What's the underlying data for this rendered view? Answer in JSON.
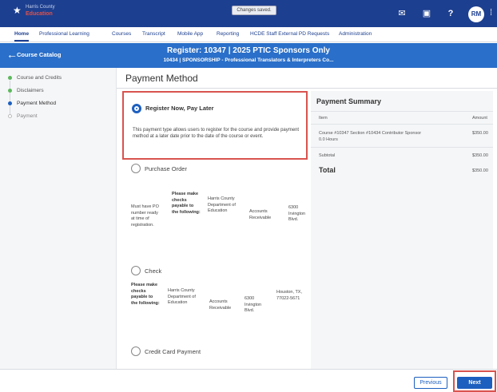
{
  "topbar": {
    "logo_top": "Harris County",
    "logo_bottom": "Education",
    "toast": "Changes saved.",
    "avatar_initials": "RM"
  },
  "nav": {
    "items": [
      "Home",
      "Professional Learning",
      "Courses",
      "Transcript",
      "Mobile App",
      "Reporting",
      "HCDE Staff External PD Requests",
      "Administration"
    ]
  },
  "header": {
    "back_label": "Course Catalog",
    "title": "Register: 10347 | 2025 PTIC Sponsors Only",
    "subtitle": "10434 | SPONSORSHIP - Professional Translators & Interpreters Co..."
  },
  "sidebar": {
    "steps": [
      "Course and Credits",
      "Disclaimers",
      "Payment Method",
      "Payment"
    ]
  },
  "main": {
    "title": "Payment Method",
    "options": {
      "register_now": {
        "label": "Register Now, Pay Later",
        "description": "This payment type allows users to register for the course and provide payment method at a later date prior to the date of the course or event."
      },
      "purchase_order": {
        "label": "Purchase Order",
        "info": [
          "Must have PO number ready at time of registration.",
          "Please make checks payable to the following:",
          "Harris County Department of Education",
          "Accounts Receivable",
          "6300 Irvington Blvd."
        ]
      },
      "check": {
        "label": "Check",
        "info": [
          "Please make checks payable to the following:",
          "Harris County Department of Education",
          "Accounts Receivable",
          "6300 Irvington Blvd.",
          "Houston, TX, 77022-5671"
        ]
      },
      "credit_card": {
        "label": "Credit Card Payment"
      }
    }
  },
  "summary": {
    "title": "Payment Summary",
    "col_item": "Item",
    "col_amount": "Amount",
    "line_item": "Course #10347 Section #10434 Contributor Sponsor",
    "line_hours": "0.0 Hours",
    "line_amount": "$350.00",
    "subtotal_label": "Subtotal",
    "subtotal_amount": "$350.00",
    "total_label": "Total",
    "total_amount": "$350.00"
  },
  "footer": {
    "previous": "Previous",
    "next": "Next"
  },
  "colors": {
    "topbar": "#1d3f8f",
    "header": "#2a6fc9",
    "accent": "#1d5fbf",
    "highlight": "#d9534f",
    "step_done": "#5cb85c"
  }
}
